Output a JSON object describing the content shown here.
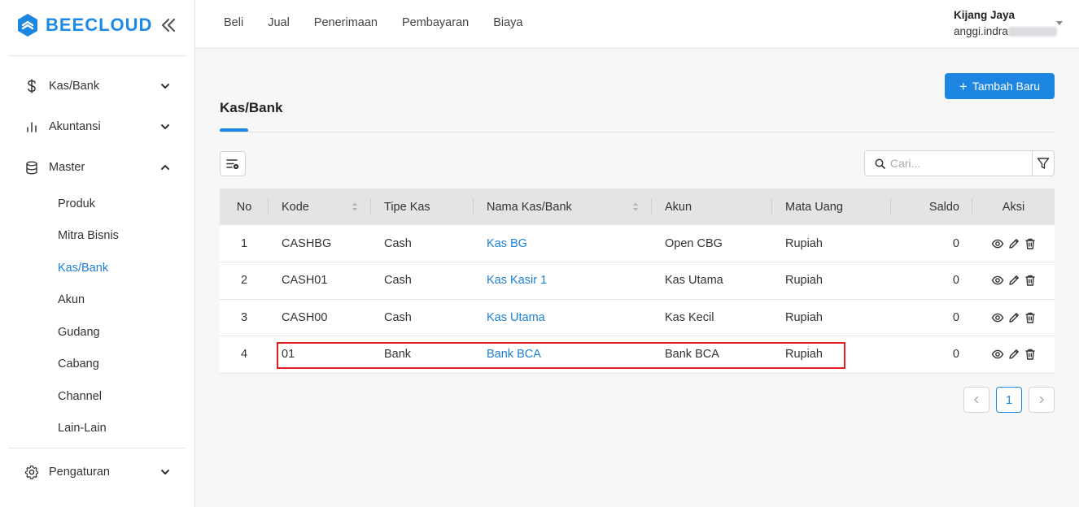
{
  "brand": {
    "name": "BEECLOUD",
    "accent": "#1c86e0"
  },
  "sidebar": {
    "items": [
      {
        "label": "Kas/Bank",
        "icon": "dollar-icon",
        "expanded": false
      },
      {
        "label": "Akuntansi",
        "icon": "bar-chart-icon",
        "expanded": false
      },
      {
        "label": "Master",
        "icon": "database-icon",
        "expanded": true
      }
    ],
    "submenu": [
      {
        "label": "Produk"
      },
      {
        "label": "Mitra Bisnis"
      },
      {
        "label": "Kas/Bank",
        "active": true
      },
      {
        "label": "Akun"
      },
      {
        "label": "Gudang"
      },
      {
        "label": "Cabang"
      },
      {
        "label": "Channel"
      },
      {
        "label": "Lain-Lain"
      }
    ],
    "settings": {
      "label": "Pengaturan",
      "icon": "gear-icon"
    }
  },
  "topnav": [
    "Beli",
    "Jual",
    "Penerimaan",
    "Pembayaran",
    "Biaya"
  ],
  "user": {
    "company": "Kijang Jaya",
    "email_visible": "anggi.indra"
  },
  "page": {
    "title": "Kas/Bank",
    "add_button": "Tambah Baru",
    "search_placeholder": "Cari..."
  },
  "table": {
    "columns": [
      "No",
      "Kode",
      "Tipe Kas",
      "Nama Kas/Bank",
      "Akun",
      "Mata Uang",
      "Saldo",
      "Aksi"
    ],
    "rows": [
      {
        "no": "1",
        "kode": "CASHBG",
        "tipe": "Cash",
        "nama": "Kas BG",
        "akun": "Open CBG",
        "mata_uang": "Rupiah",
        "saldo": "0"
      },
      {
        "no": "2",
        "kode": "CASH01",
        "tipe": "Cash",
        "nama": "Kas Kasir 1",
        "akun": "Kas Utama",
        "mata_uang": "Rupiah",
        "saldo": "0"
      },
      {
        "no": "3",
        "kode": "CASH00",
        "tipe": "Cash",
        "nama": "Kas Utama",
        "akun": "Kas Kecil",
        "mata_uang": "Rupiah",
        "saldo": "0"
      },
      {
        "no": "4",
        "kode": "01",
        "tipe": "Bank",
        "nama": "Bank BCA",
        "akun": "Bank BCA",
        "mata_uang": "Rupiah",
        "saldo": "0"
      }
    ],
    "highlight_color": "#e21e24"
  },
  "pagination": {
    "current": "1"
  }
}
